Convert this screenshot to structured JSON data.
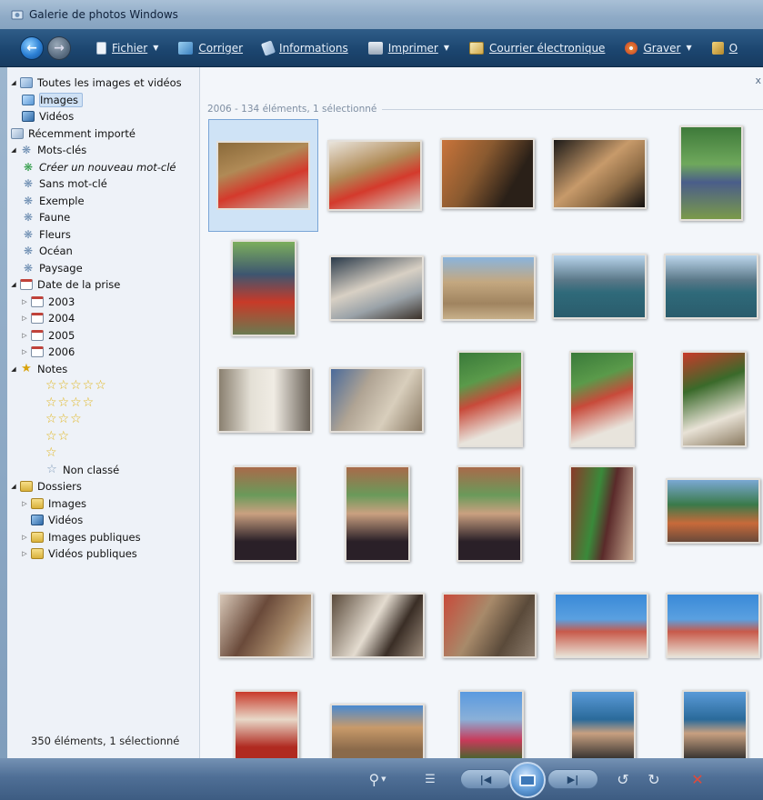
{
  "window": {
    "title": "Galerie de photos Windows"
  },
  "toolbar": {
    "items": [
      {
        "label": "Fichier",
        "caret": true
      },
      {
        "label": "Corriger",
        "caret": false
      },
      {
        "label": "Informations",
        "caret": false
      },
      {
        "label": "Imprimer",
        "caret": true
      },
      {
        "label": "Courrier électronique",
        "caret": false
      },
      {
        "label": "Graver",
        "caret": true
      },
      {
        "label": "O",
        "caret": false
      }
    ]
  },
  "sidebar": {
    "all": "Toutes les images et vidéos",
    "images": "Images",
    "videos": "Vidéos",
    "recent": "Récemment importé",
    "tags": "Mots-clés",
    "create_tag": "Créer un nouveau mot-clé",
    "no_tag": "Sans mot-clé",
    "tag_items": [
      "Exemple",
      "Faune",
      "Fleurs",
      "Océan",
      "Paysage"
    ],
    "date": "Date de la prise",
    "years": [
      "2003",
      "2004",
      "2005",
      "2006"
    ],
    "notes": "Notes",
    "rating_rows": [
      "☆☆☆☆☆",
      "☆☆☆☆",
      "☆☆☆",
      "☆☆",
      "☆"
    ],
    "unrated": "Non classé",
    "folders": "Dossiers",
    "folder_items": [
      "Images",
      "Vidéos",
      "Images publiques",
      "Vidéos publiques"
    ],
    "status": "350 éléments, 1 sélectionné"
  },
  "content": {
    "group_header": "2006 - 134 éléments, 1 sélectionné",
    "corner": "x"
  },
  "colors": {
    "toolbar_bg": "#1c4670",
    "sidebar_bg": "#eef2f8",
    "content_bg": "#f3f6fa",
    "selection": "#cfe1f5"
  }
}
